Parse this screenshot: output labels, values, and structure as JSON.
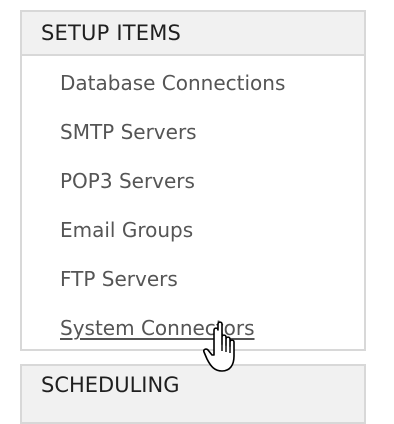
{
  "setup_panel": {
    "title": "SETUP ITEMS",
    "items": [
      {
        "label": "Database Connections"
      },
      {
        "label": "SMTP Servers"
      },
      {
        "label": "POP3 Servers"
      },
      {
        "label": "Email Groups"
      },
      {
        "label": "FTP Servers"
      },
      {
        "label": "System Connectors"
      }
    ]
  },
  "scheduling_panel": {
    "title": "SCHEDULING"
  },
  "cursor": {
    "icon": "hand-pointer-icon"
  }
}
